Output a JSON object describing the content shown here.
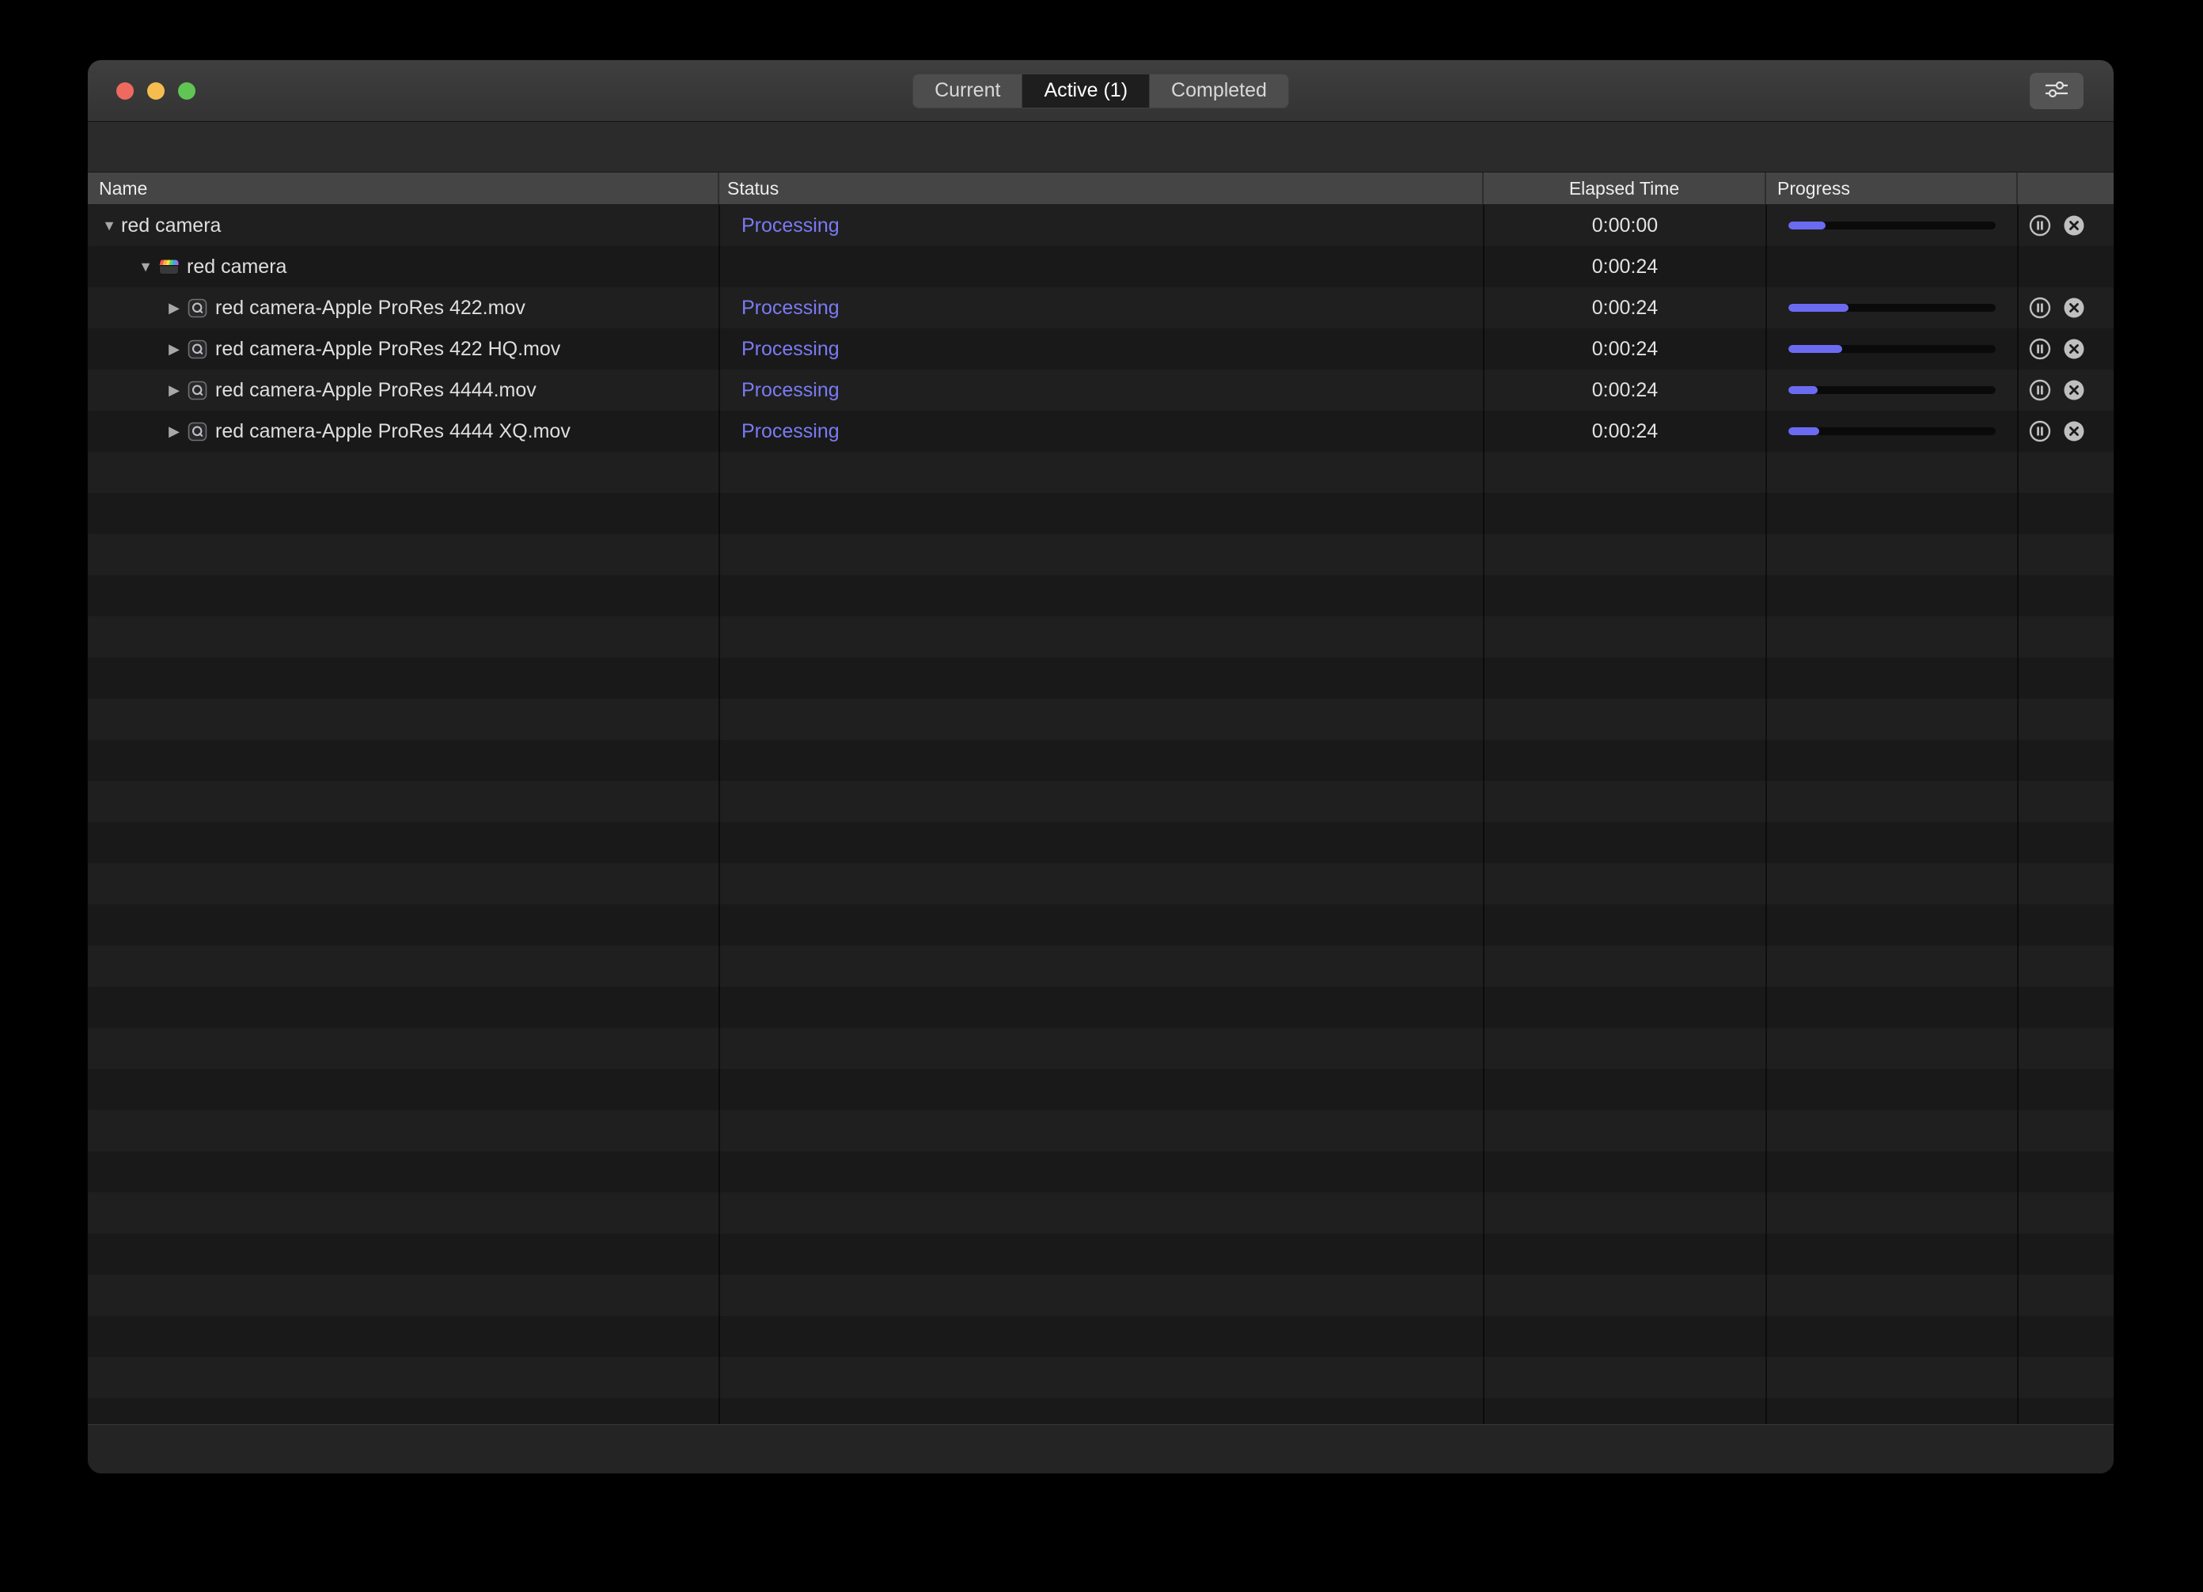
{
  "window": {
    "traffic_lights": [
      {
        "name": "close"
      },
      {
        "name": "minimize"
      },
      {
        "name": "zoom"
      }
    ],
    "tabs": [
      {
        "label": "Current",
        "selected": false
      },
      {
        "label": "Active (1)",
        "selected": true
      },
      {
        "label": "Completed",
        "selected": false
      }
    ],
    "settings_button": {
      "icon": "sliders-icon"
    }
  },
  "table": {
    "columns": [
      {
        "label": "Name"
      },
      {
        "label": "Status"
      },
      {
        "label": "Elapsed Time"
      },
      {
        "label": "Progress"
      }
    ],
    "rows": [
      {
        "name": "red camera",
        "level": 0,
        "disclosure": "expanded",
        "icon": "none",
        "status": "Processing",
        "elapsed": "0:00:00",
        "progress_percent": 18,
        "controls": true
      },
      {
        "name": "red camera",
        "level": 1,
        "disclosure": "expanded",
        "icon": "clapboard-icon",
        "status": "",
        "elapsed": "0:00:24",
        "progress_percent": null,
        "controls": false
      },
      {
        "name": "red camera-Apple ProRes 422.mov",
        "level": 2,
        "disclosure": "collapsed",
        "icon": "movie-icon",
        "status": "Processing",
        "elapsed": "0:00:24",
        "progress_percent": 29,
        "controls": true
      },
      {
        "name": "red camera-Apple ProRes 422 HQ.mov",
        "level": 2,
        "disclosure": "collapsed",
        "icon": "movie-icon",
        "status": "Processing",
        "elapsed": "0:00:24",
        "progress_percent": 26,
        "controls": true
      },
      {
        "name": "red camera-Apple ProRes 4444.mov",
        "level": 2,
        "disclosure": "collapsed",
        "icon": "movie-icon",
        "status": "Processing",
        "elapsed": "0:00:24",
        "progress_percent": 14,
        "controls": true
      },
      {
        "name": "red camera-Apple ProRes 4444 XQ.mov",
        "level": 2,
        "disclosure": "collapsed",
        "icon": "movie-icon",
        "status": "Processing",
        "elapsed": "0:00:24",
        "progress_percent": 15,
        "controls": true
      }
    ]
  },
  "colors": {
    "accent": "#6b6bf2",
    "processing_text": "#7a7af5"
  }
}
